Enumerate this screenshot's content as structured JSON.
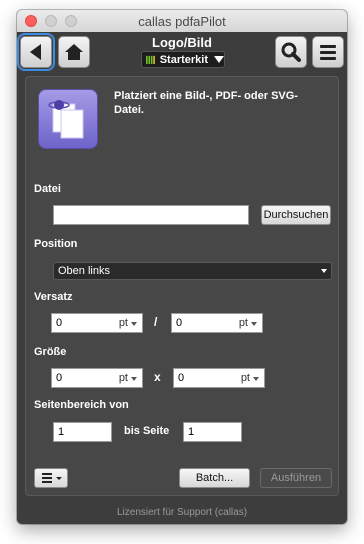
{
  "window": {
    "title": "callas pdfaPilot"
  },
  "toolbar": {
    "title": "Logo/Bild",
    "profile": "Starterkit",
    "icons": {
      "back": "back-arrow-icon",
      "home": "home-icon",
      "search": "search-icon",
      "menu": "hamburger-menu-icon"
    }
  },
  "panel": {
    "description": "Platziert eine Bild-, PDF- oder SVG-Datei.",
    "file": {
      "label": "Datei",
      "value": "",
      "browse_label": "Durchsuchen"
    },
    "position": {
      "label": "Position",
      "selected": "Oben links"
    },
    "offset": {
      "label": "Versatz",
      "x_value": "0",
      "x_unit": "pt",
      "separator": "/",
      "y_value": "0",
      "y_unit": "pt"
    },
    "size": {
      "label": "Größe",
      "w_value": "0",
      "w_unit": "pt",
      "separator": "x",
      "h_value": "0",
      "h_unit": "pt"
    },
    "page_range": {
      "label": "Seitenbereich von",
      "from_value": "1",
      "to_label": "bis Seite",
      "to_value": "1"
    },
    "actions": {
      "batch_label": "Batch...",
      "run_label": "Ausführen"
    }
  },
  "footer": {
    "license": "Lizensiert für Support (callas)"
  },
  "colors": {
    "window_bg": "#3d3d3d",
    "panel_bg": "#474747",
    "accent": "#3b8de1",
    "profile_badge": "#6ec12a"
  }
}
